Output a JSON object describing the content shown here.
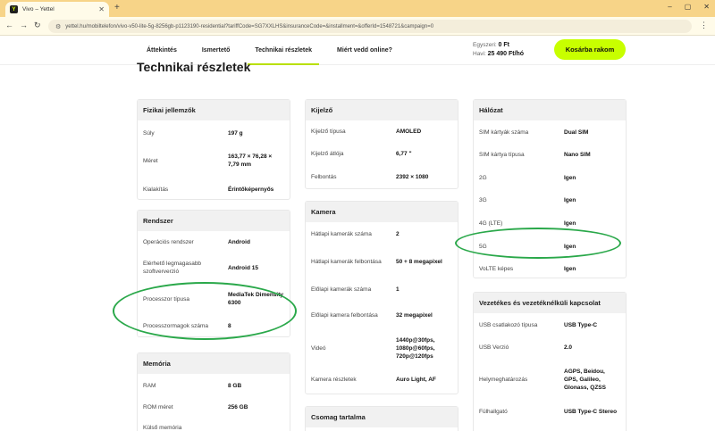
{
  "browser": {
    "tab_title": "Vivo – Yettel",
    "favicon_letter": "Y",
    "new_tab": "+",
    "url": "yettel.hu/mobiltelefon/vivo-v50-lite-5g-8256gb-p1123190-residential?tariffCode=SG7XXLHS&insuranceCode=&installment=&offerId=1548721&campaign=0"
  },
  "header": {
    "nav": [
      "Áttekintés",
      "Ismertető",
      "Technikai részletek",
      "Miért vedd online?"
    ],
    "price_once_label": "Egyszeri:",
    "price_once": "0 Ft",
    "price_month_label": "Havi:",
    "price_month": "25 490 Ft/hó",
    "cart_button": "Kosárba rakom"
  },
  "page_title": "Technikai részletek",
  "col1": {
    "fizikai": {
      "title": "Fizikai jellemzők",
      "rows": [
        {
          "label": "Súly",
          "value": "197 g"
        },
        {
          "label": "Méret",
          "value": "163,77 × 76,28 × 7,79 mm"
        },
        {
          "label": "Kialakítás",
          "value": "Érintőképernyős"
        }
      ]
    },
    "rendszer": {
      "title": "Rendszer",
      "rows": [
        {
          "label": "Operációs rendszer",
          "value": "Android"
        },
        {
          "label": "Elérhető legmagasabb szoftververzió",
          "value": "Android 15"
        },
        {
          "label": "Processzor típusa",
          "value": "MediaTek Dimensity 6300"
        },
        {
          "label": "Processzormagok száma",
          "value": "8"
        }
      ]
    },
    "memoria": {
      "title": "Memória",
      "rows": [
        {
          "label": "RAM",
          "value": "8 GB"
        },
        {
          "label": "ROM méret",
          "value": "256 GB"
        },
        {
          "label": "Külső memória",
          "value": ""
        }
      ]
    }
  },
  "col2": {
    "kijelzo": {
      "title": "Kijelző",
      "rows": [
        {
          "label": "Kijelző típusa",
          "value": "AMOLED"
        },
        {
          "label": "Kijelző átlója",
          "value": "6,77 \""
        },
        {
          "label": "Felbontás",
          "value": "2392 × 1080"
        }
      ]
    },
    "kamera": {
      "title": "Kamera",
      "rows": [
        {
          "label": "Hátlapi kamerák száma",
          "value": "2"
        },
        {
          "label": "Hátlapi kamerák felbontása",
          "value": "50 + 8 megapixel"
        },
        {
          "label": "Előlapi kamerák száma",
          "value": "1"
        },
        {
          "label": "Előlapi kamera felbontása",
          "value": "32 megapixel"
        },
        {
          "label": "Videó",
          "value": "1440p@30fps, 1080p@60fps, 720p@120fps"
        },
        {
          "label": "Kamera részletek",
          "value": "Auro Light, AF"
        }
      ]
    },
    "csomag": {
      "title": "Csomag tartalma"
    }
  },
  "col3": {
    "halozat": {
      "title": "Hálózat",
      "rows": [
        {
          "label": "SIM kártyák száma",
          "value": "Dual SIM"
        },
        {
          "label": "SIM kártya típusa",
          "value": "Nano SIM"
        },
        {
          "label": "2G",
          "value": "Igen"
        },
        {
          "label": "3G",
          "value": "Igen"
        },
        {
          "label": "4G (LTE)",
          "value": "Igen"
        },
        {
          "label": "5G",
          "value": "Igen"
        },
        {
          "label": "VoLTE képes",
          "value": "Igen"
        }
      ]
    },
    "kapcsolat": {
      "title": "Vezetékes és vezetéknélküli kapcsolat",
      "rows": [
        {
          "label": "USB csatlakozó típusa",
          "value": "USB Type-C"
        },
        {
          "label": "USB Verzió",
          "value": "2.0"
        },
        {
          "label": "Helymeghatározás",
          "value": "AGPS, Beidou, GPS, Galileo, Glonass, QZSS"
        },
        {
          "label": "Fülhallgató",
          "value": "USB Type-C Stereo"
        }
      ]
    }
  },
  "colors": {
    "accent": "#c8ff00",
    "annotation": "#2aa84a"
  }
}
